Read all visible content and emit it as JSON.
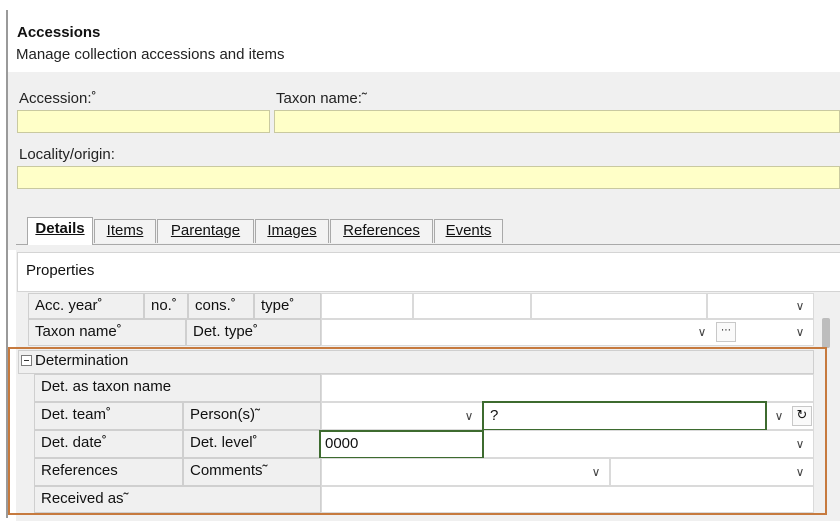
{
  "header": {
    "title": "Accessions",
    "subtitle": "Manage collection accessions and items"
  },
  "form": {
    "accession_label": "Accession:˚",
    "accession_value": "",
    "taxon_label": "Taxon name:˜",
    "taxon_value": "",
    "locality_label": "Locality/origin:",
    "locality_value": ""
  },
  "tabs": [
    {
      "label": "Details",
      "active": true
    },
    {
      "label": "Items",
      "active": false
    },
    {
      "label": "Parentage",
      "active": false
    },
    {
      "label": "Images",
      "active": false
    },
    {
      "label": "References",
      "active": false
    },
    {
      "label": "Events",
      "active": false
    }
  ],
  "properties": {
    "title": "Properties",
    "rows": {
      "acc_year": "Acc. year˚",
      "no": "no.˚",
      "cons": "cons.˚",
      "type": "type˚",
      "taxon_name": "Taxon name˚",
      "det_type": "Det. type˚"
    }
  },
  "determination": {
    "title": "Determination",
    "det_as_taxon": "Det. as taxon name",
    "det_team": "Det. team˚",
    "persons": "Person(s)˜",
    "persons_value": "?",
    "det_date": "Det. date˚",
    "det_level": "Det. level˚",
    "det_date_value": "0000",
    "references": "References",
    "comments": "Comments˜",
    "received_as": "Received as˜"
  },
  "icons": {
    "dropdown": "chevron-down-icon",
    "more": "ellipsis-icon",
    "refresh": "refresh-icon",
    "collapse": "minus-box-icon"
  },
  "colors": {
    "highlight_frame": "#c67a3e",
    "focus_box": "#3d6b2f",
    "input_yellow": "#ffffc8"
  }
}
